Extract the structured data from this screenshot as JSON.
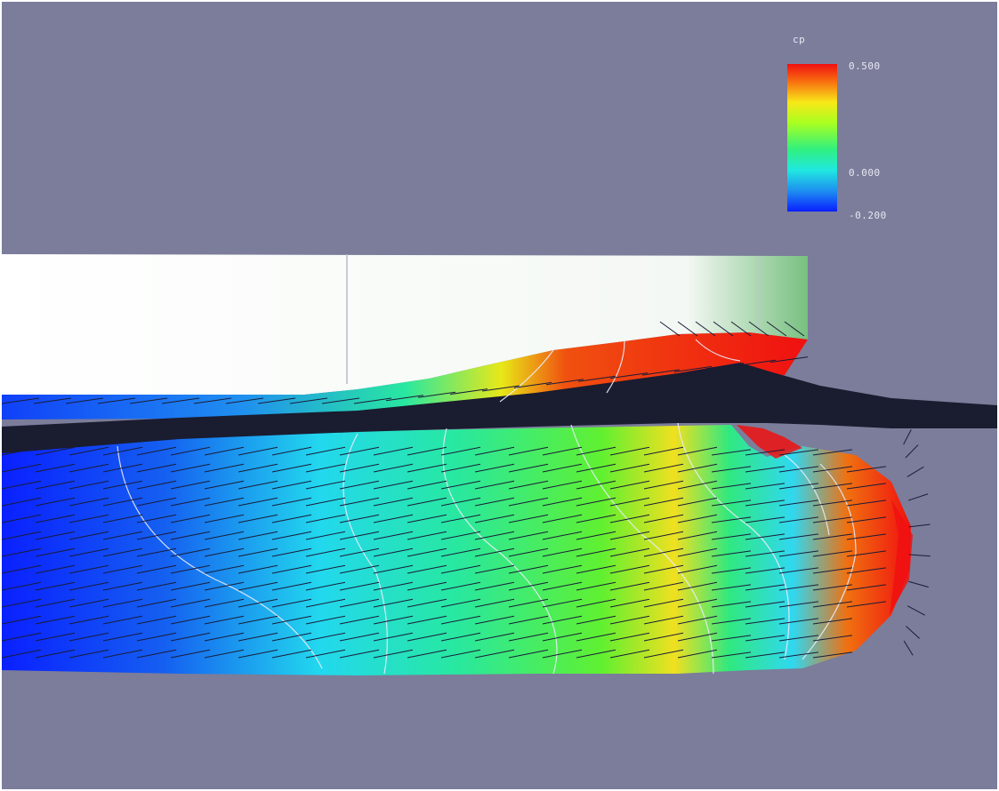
{
  "legend": {
    "variable": "cp",
    "max_label": "0.500",
    "mid_label": "0.000",
    "min_label": "-0.200",
    "colormap": [
      "#0a1fff",
      "#1e8ff0",
      "#20e8e0",
      "#30f080",
      "#a8ff20",
      "#f8e818",
      "#f87010",
      "#f01010"
    ]
  },
  "colors": {
    "background": "#7b7d9a",
    "hull_above_water": "#ffffff",
    "wave_surface": "#1a1c30",
    "vectors": "#1a1c38",
    "contour_lines": "#e8ecf8"
  }
}
